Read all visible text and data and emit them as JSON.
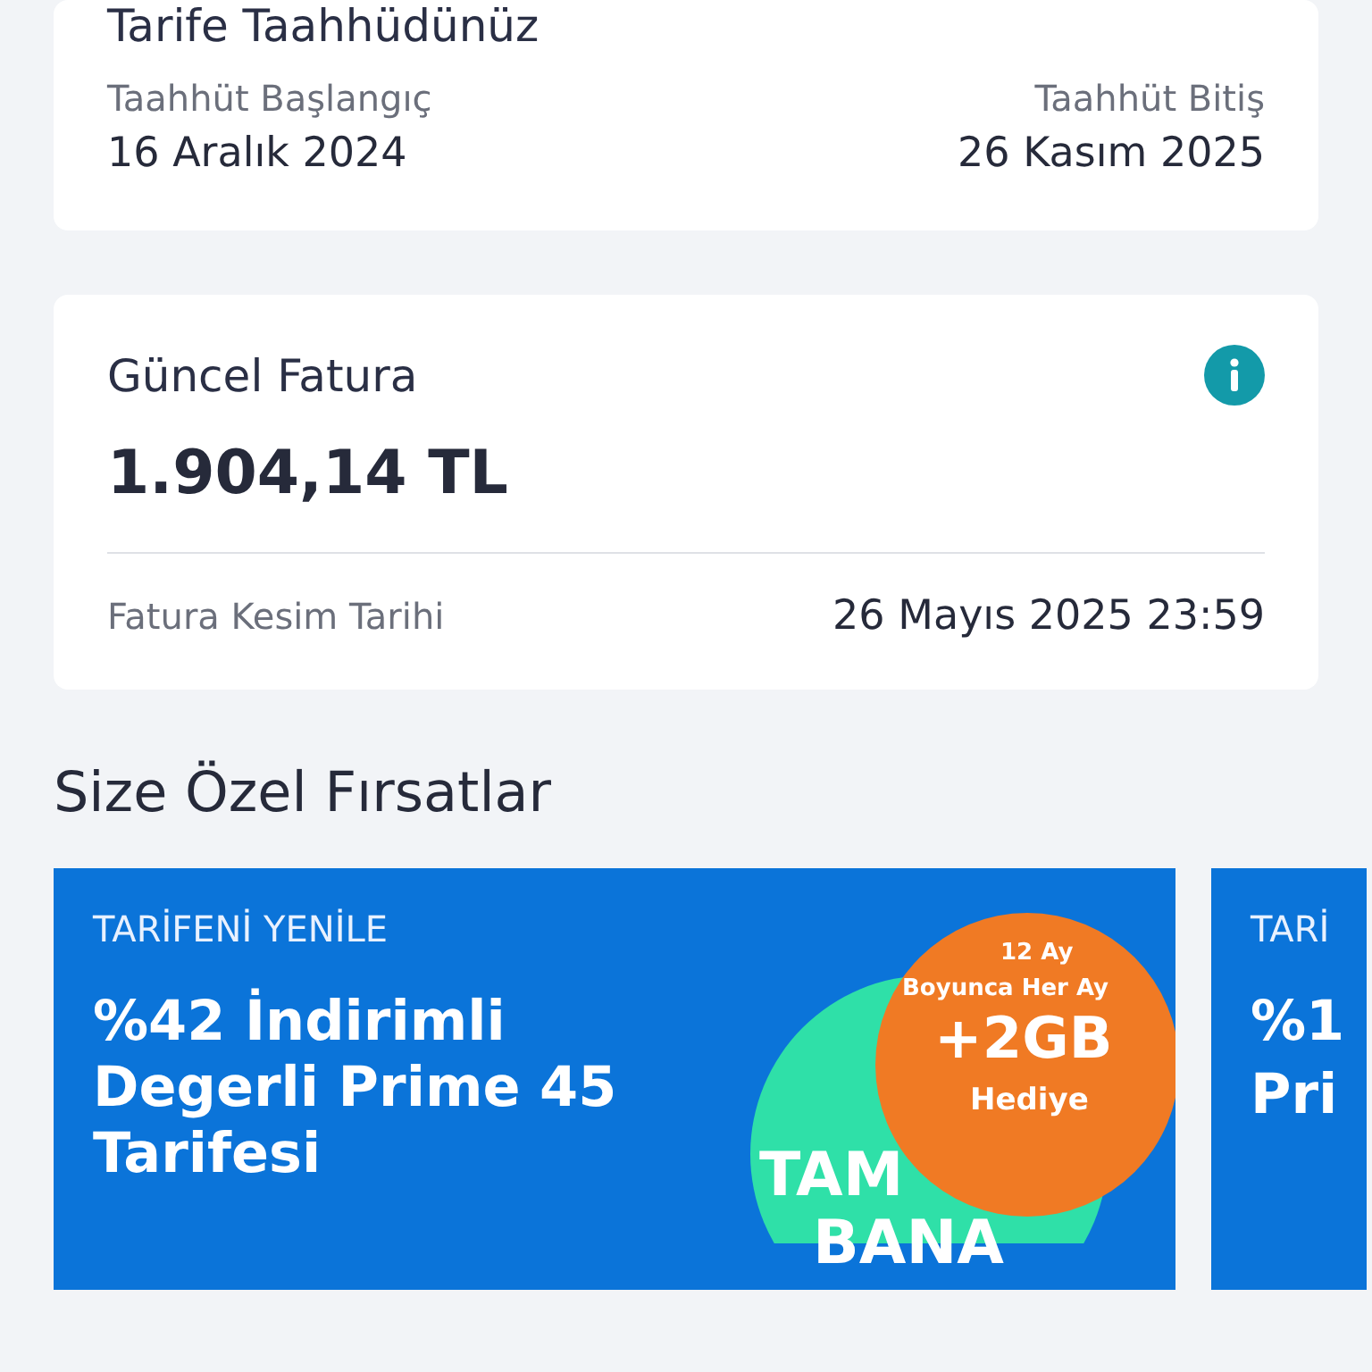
{
  "commitment": {
    "title": "Tarife Taahhüdünüz",
    "start_label": "Taahhüt Başlangıç",
    "start_value": "16 Aralık 2024",
    "end_label": "Taahhüt Bitiş",
    "end_value": "26 Kasım 2025"
  },
  "invoice": {
    "title": "Güncel Fatura",
    "amount": "1.904,14 TL",
    "date_label": "Fatura Kesim Tarihi",
    "date_value": "26 Mayıs 2025 23:59"
  },
  "offers": {
    "heading": "Size Özel Fırsatlar",
    "cards": [
      {
        "kind": "full",
        "category": "TARİFENİ YENİLE",
        "title": "%42 İndirimli Degerli Prime 45 Tarifesi",
        "badge": {
          "line_1": "12 Ay",
          "line_2": "Boyunca Her Ay",
          "highlight": "+2GB",
          "line_3": "Hediye",
          "brand_1": "TAM",
          "brand_2": "BANA"
        }
      },
      {
        "kind": "partial",
        "category": "TARİ",
        "title_1": "%1",
        "title_2": "Pri"
      }
    ]
  }
}
